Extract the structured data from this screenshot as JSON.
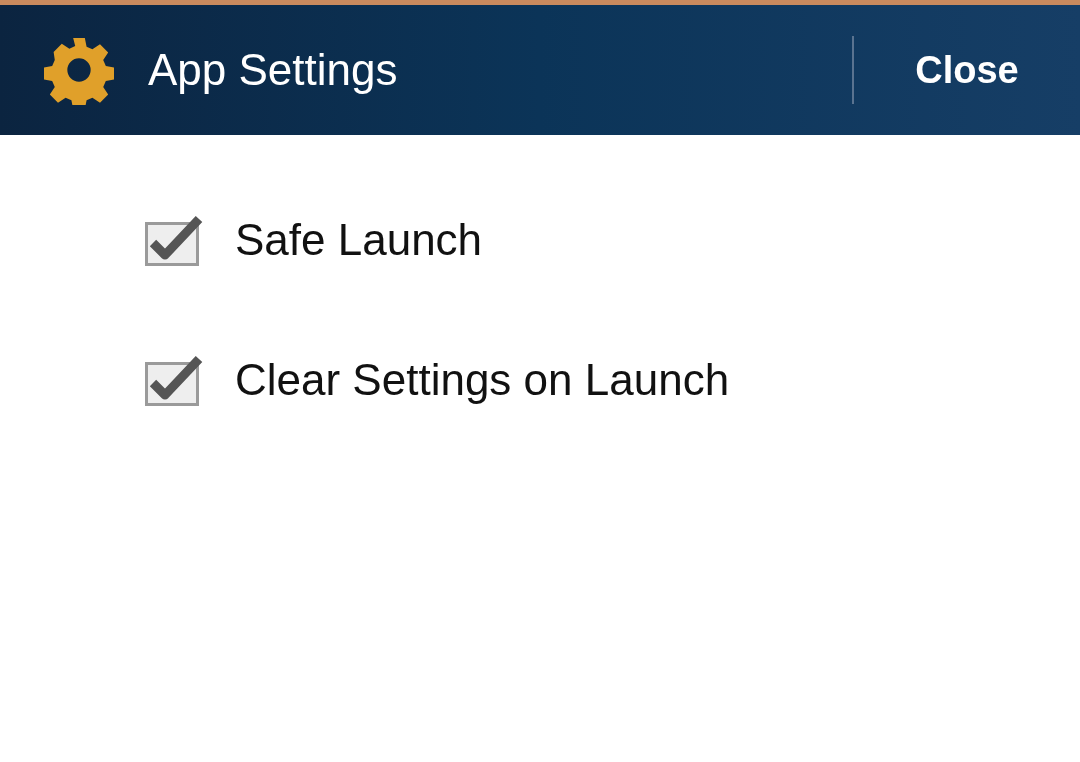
{
  "header": {
    "title": "App Settings",
    "close_label": "Close"
  },
  "options": [
    {
      "label": "Safe Launch",
      "checked": true
    },
    {
      "label": "Clear Settings on Launch",
      "checked": true
    }
  ]
}
